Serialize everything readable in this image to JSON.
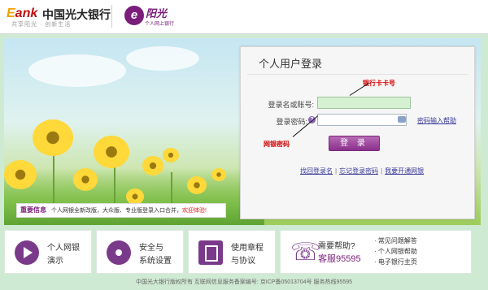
{
  "header": {
    "logo_e": "E",
    "logo_ank": "ank",
    "bank_name": "中国光大银行",
    "slogan": "共享阳光 · 创新生活",
    "yg_mark": "e",
    "yg_name": "阳光",
    "yg_sub": "个人网上银行"
  },
  "login": {
    "title": "个人用户登录",
    "username_label": "登录名或账号:",
    "password_label": "登录密码:",
    "help_icon": "?",
    "keyboard_link": "密码输入帮助",
    "submit": "登 录",
    "links": [
      "找回登录名",
      "忘记登录密码",
      "我要开通网银"
    ],
    "annot_card": "银行卡卡号",
    "annot_pwd": "网银密码"
  },
  "info": {
    "label": "重要信息",
    "text_prefix": "个人网银全新改版，大众版、专业版登录入口合并，",
    "text_highlight": "欢迎体验!"
  },
  "features": [
    {
      "icon": "play-icon",
      "line1": "个人网银",
      "line2": "演示"
    },
    {
      "icon": "gear-icon",
      "line1": "安全与",
      "line2": "系统设置"
    },
    {
      "icon": "book-icon",
      "line1": "使用章程",
      "line2": "与协议"
    }
  ],
  "help": {
    "icon": "phone-icon",
    "title": "需要帮助?",
    "hotline": "客服95595",
    "list": [
      "常见问题解答",
      "个人网银帮助",
      "电子银行主页"
    ]
  },
  "footer": "中国光大银行版权所有 互联网信息服务备案编号: 京ICP备05013704号 服务热线95595"
}
